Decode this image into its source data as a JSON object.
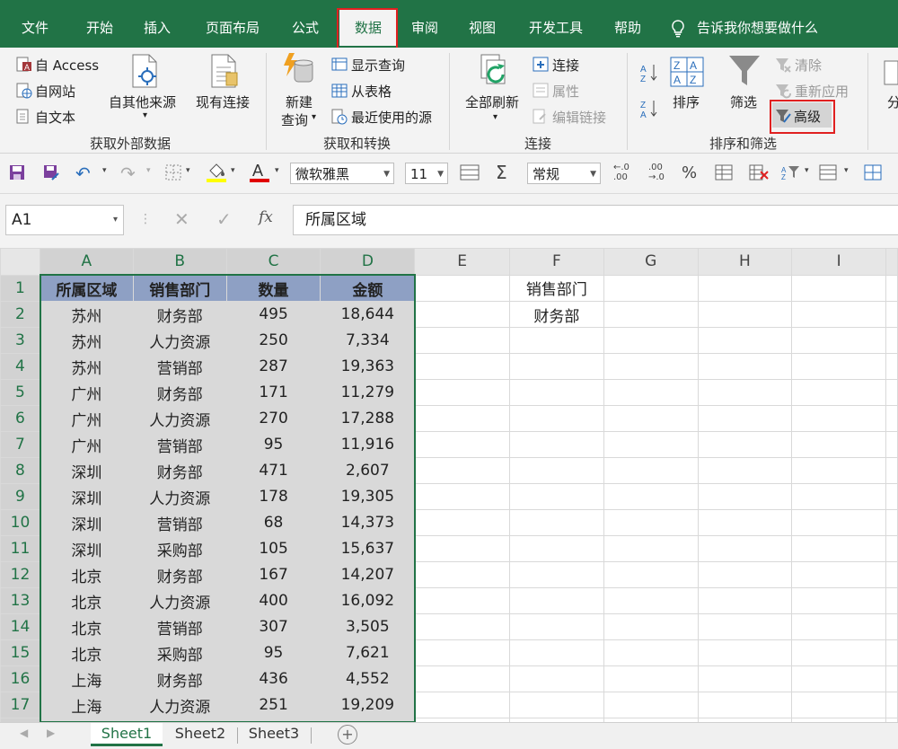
{
  "menu_tabs": [
    "文件",
    "开始",
    "插入",
    "页面布局",
    "公式",
    "数据",
    "审阅",
    "视图",
    "开发工具",
    "帮助"
  ],
  "active_tab": "数据",
  "tell_me": "告诉我你想要做什么",
  "ribbon": {
    "external": {
      "access": "自 Access",
      "web": "自网站",
      "text": "自文本",
      "other": "自其他来源",
      "existing": "现有连接",
      "label": "获取外部数据"
    },
    "transform": {
      "new_query_1": "新建",
      "new_query_2": "查询",
      "show_queries": "显示查询",
      "from_table": "从表格",
      "recent": "最近使用的源",
      "label": "获取和转换"
    },
    "connections": {
      "refresh_all": "全部刷新",
      "connections": "连接",
      "properties": "属性",
      "edit_links": "编辑链接",
      "label": "连接"
    },
    "sort_filter": {
      "sort": "排序",
      "filter": "筛选",
      "clear": "清除",
      "reapply": "重新应用",
      "advanced": "高级",
      "label": "排序和筛选"
    },
    "cut_off": "分"
  },
  "qat": {
    "font_name": "微软雅黑",
    "font_size": "11",
    "number_format": "常规",
    "percent": "%"
  },
  "formula_bar": {
    "name_box": "A1",
    "fx": "fx",
    "content": "所属区域"
  },
  "columns": [
    "A",
    "B",
    "C",
    "D",
    "E",
    "F",
    "G",
    "H",
    "I"
  ],
  "table_header": [
    "所属区域",
    "销售部门",
    "数量",
    "金额"
  ],
  "rows": [
    [
      "苏州",
      "财务部",
      "495",
      "18,644"
    ],
    [
      "苏州",
      "人力资源",
      "250",
      "7,334"
    ],
    [
      "苏州",
      "营销部",
      "287",
      "19,363"
    ],
    [
      "广州",
      "财务部",
      "171",
      "11,279"
    ],
    [
      "广州",
      "人力资源",
      "270",
      "17,288"
    ],
    [
      "广州",
      "营销部",
      "95",
      "11,916"
    ],
    [
      "深圳",
      "财务部",
      "471",
      "2,607"
    ],
    [
      "深圳",
      "人力资源",
      "178",
      "19,305"
    ],
    [
      "深圳",
      "营销部",
      "68",
      "14,373"
    ],
    [
      "深圳",
      "采购部",
      "105",
      "15,637"
    ],
    [
      "北京",
      "财务部",
      "167",
      "14,207"
    ],
    [
      "北京",
      "人力资源",
      "400",
      "16,092"
    ],
    [
      "北京",
      "营销部",
      "307",
      "3,505"
    ],
    [
      "北京",
      "采购部",
      "95",
      "7,621"
    ],
    [
      "上海",
      "财务部",
      "436",
      "4,552"
    ],
    [
      "上海",
      "人力资源",
      "251",
      "19,209"
    ]
  ],
  "criteria": {
    "header": "销售部门",
    "value": "财务部"
  },
  "sheets": [
    "Sheet1",
    "Sheet2",
    "Sheet3"
  ],
  "active_sheet": "Sheet1",
  "colors": {
    "excel_green": "#217346",
    "header_fill": "#8ea0c4",
    "highlight_red": "#e02020"
  }
}
